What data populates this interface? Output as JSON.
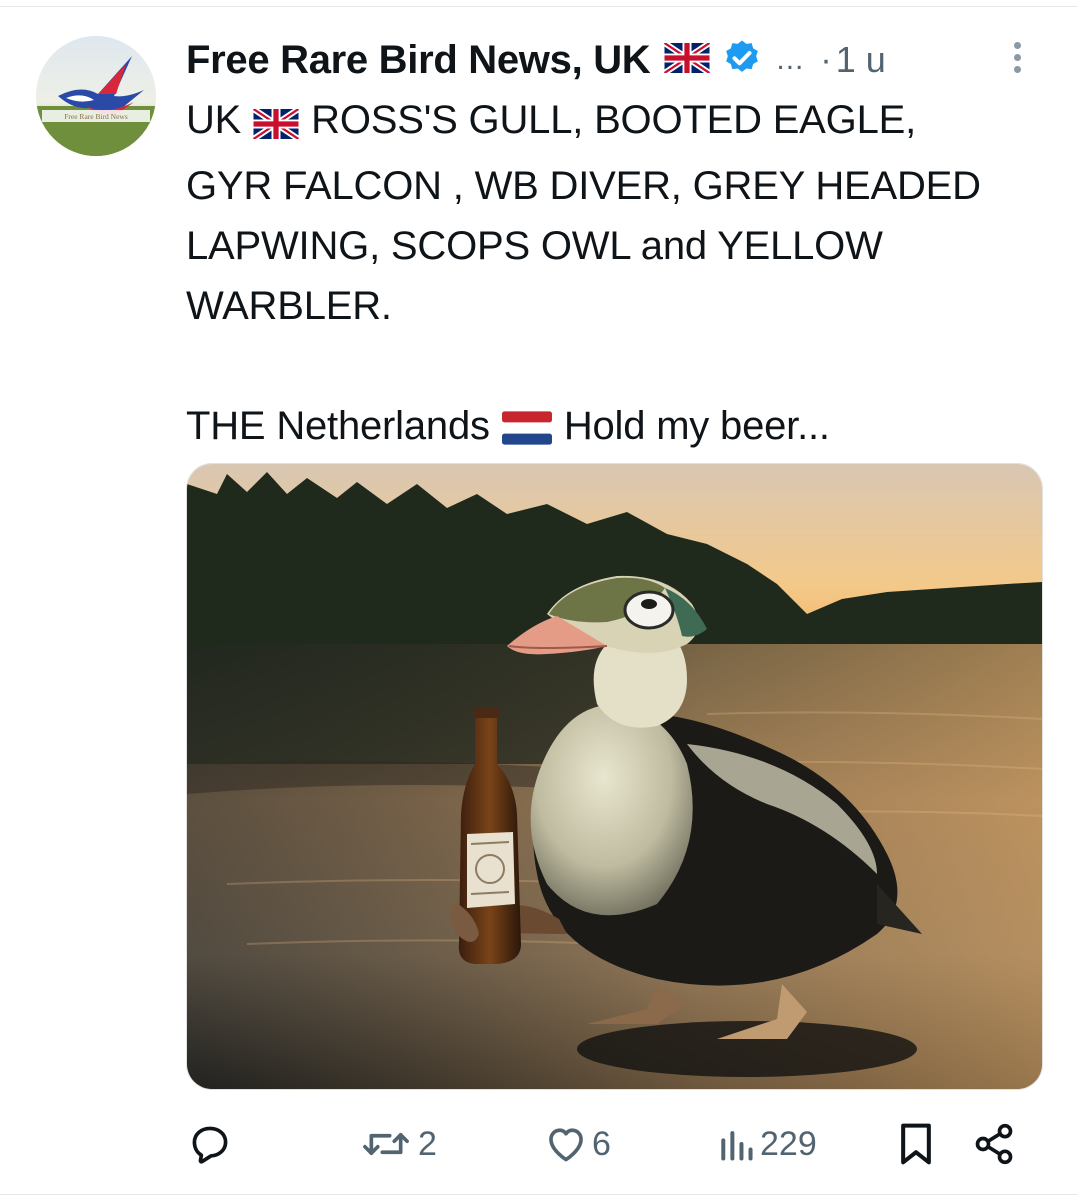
{
  "post": {
    "author_name": "Free Rare Bird News, UK",
    "author_flag": "uk-flag-icon",
    "verified": true,
    "handle_truncated": "...",
    "separator": "·",
    "time": "1 u",
    "avatar_text": "Free Rare Bird News",
    "text_line1_prefix": "UK",
    "text_line1_suffix": "ROSS'S GULL, BOOTED EAGLE,",
    "text_line2": "GYR FALCON , WB DIVER, GREY HEADED",
    "text_line3": "LAPWING, SCOPS OWL and YELLOW",
    "text_line4": "WARBLER.",
    "text_line5_prefix": "THE Netherlands",
    "text_line5_suffix": "Hold my beer...",
    "media_alt_subject": "duck-holding-beer-bottle",
    "colors": {
      "text": "#0f1419",
      "muted": "#536471",
      "verified": "#1d9bf0"
    }
  },
  "actions": {
    "replies": "",
    "reposts": "2",
    "likes": "6",
    "views": "229"
  }
}
